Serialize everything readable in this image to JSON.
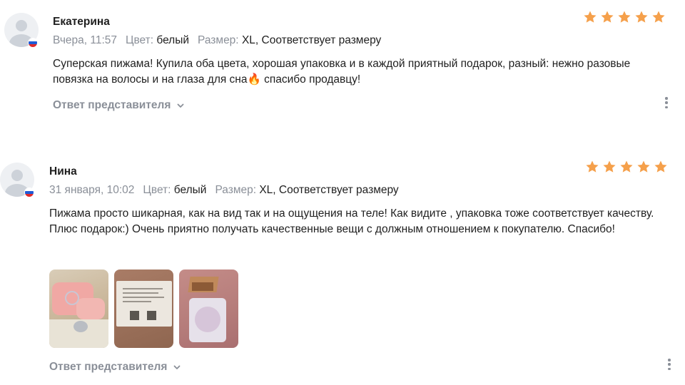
{
  "colors": {
    "star": "#f5a04b",
    "muted": "#8a8f98",
    "text": "#1f1f1f"
  },
  "reviews": [
    {
      "author": "Екатерина",
      "date": "Вчера, 11:57",
      "color_label": "Цвет:",
      "color_value": "белый",
      "size_label": "Размер:",
      "size_value": "XL, Соответствует размеру",
      "rating": 5,
      "text": "Суперская пижама! Купила оба цвета, хорошая упаковка и в каждой приятный подарок, разный: нежно разовые повязка на волосы и на глаза для сна🔥 спасибо продавцу!",
      "reply_label": "Ответ представителя",
      "flag": "ru-flag-icon"
    },
    {
      "author": "Нина",
      "date": "31 января, 10:02",
      "color_label": "Цвет:",
      "color_value": "белый",
      "size_label": "Размер:",
      "size_value": "XL, Соответствует размеру",
      "rating": 5,
      "text": "Пижама просто шикарная, как на вид так и на ощущения на теле! Как видите , упаковка тоже соответствует качеству. Плюс подарок:) Очень приятно получать качественные вещи с должным отношением к покупателю. Спасибо!",
      "reply_label": "Ответ представителя",
      "flag": "ru-flag-icon"
    }
  ]
}
